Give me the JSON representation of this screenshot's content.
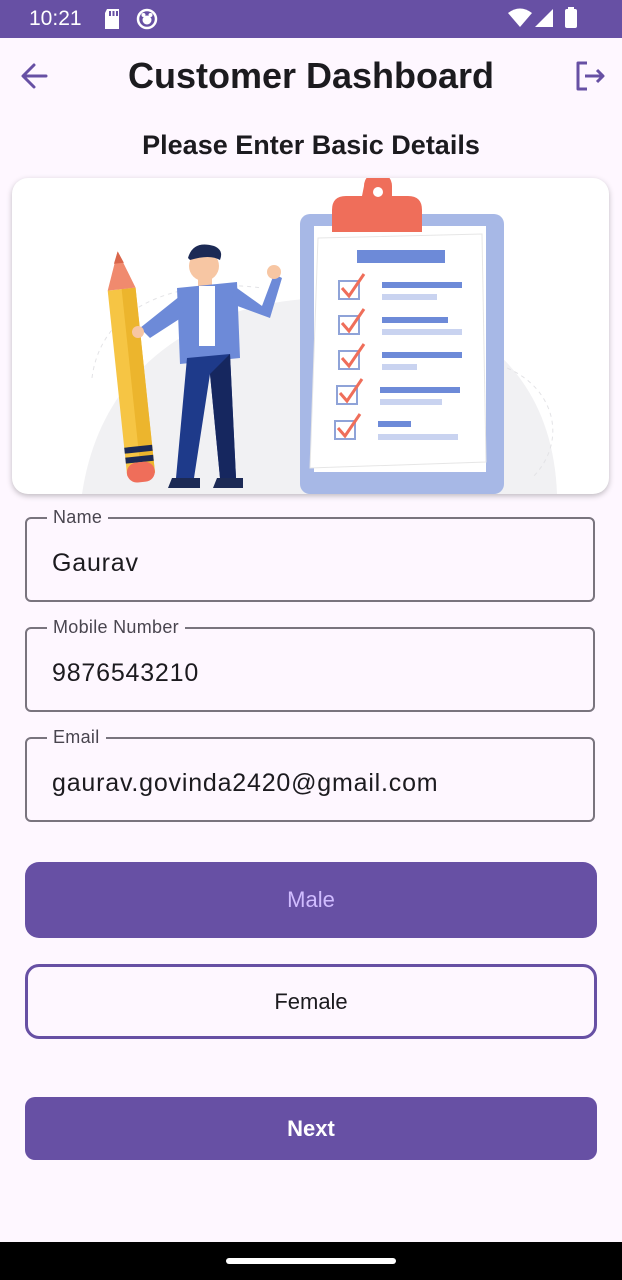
{
  "status_bar": {
    "time": "10:21",
    "icons": [
      "sd-card-icon",
      "notification-icon",
      "wifi-icon",
      "signal-icon",
      "battery-icon"
    ]
  },
  "app_bar": {
    "title": "Customer Dashboard",
    "back_icon": "arrow-back-icon",
    "logout_icon": "logout-icon"
  },
  "subtitle": "Please Enter Basic Details",
  "form": {
    "name": {
      "label": "Name",
      "value": "Gaurav"
    },
    "mobile": {
      "label": "Mobile Number",
      "value": "9876543210"
    },
    "email": {
      "label": "Email",
      "value": "gaurav.govinda2420@gmail.com"
    }
  },
  "gender": {
    "male_label": "Male",
    "female_label": "Female",
    "selected": "Male"
  },
  "next_label": "Next",
  "colors": {
    "primary": "#6750a4",
    "primary_light_text": "#d0bcff",
    "background": "#fef7ff",
    "outline": "#79747e"
  }
}
